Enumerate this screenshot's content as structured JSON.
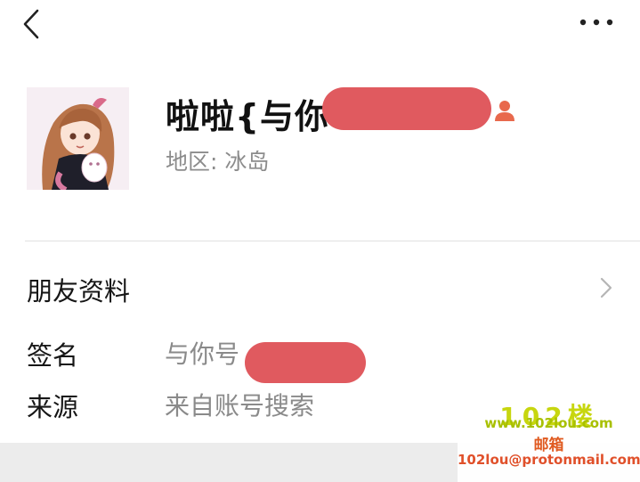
{
  "topbar": {
    "back_icon": "chevron-left-icon",
    "more_icon": "more-horizontal-icon"
  },
  "profile": {
    "name": "啦啦{与你",
    "region": "地区: 冰岛",
    "contact_icon": "contact-person-icon",
    "contact_icon_color": "#e8694d"
  },
  "details": {
    "friend_info_label": "朋友资料",
    "signature_label": "签名",
    "signature_value": "与你号",
    "source_label": "来源",
    "source_value": "来自账号搜索"
  },
  "watermark": {
    "logo": "102楼",
    "site": "www.102lou.com",
    "mail_label": "邮箱",
    "email": "102lou@protonmail.com"
  },
  "colors": {
    "redaction": "#e05a5f",
    "secondary_text": "#8a8a8a",
    "divider": "#e2e2e2"
  }
}
